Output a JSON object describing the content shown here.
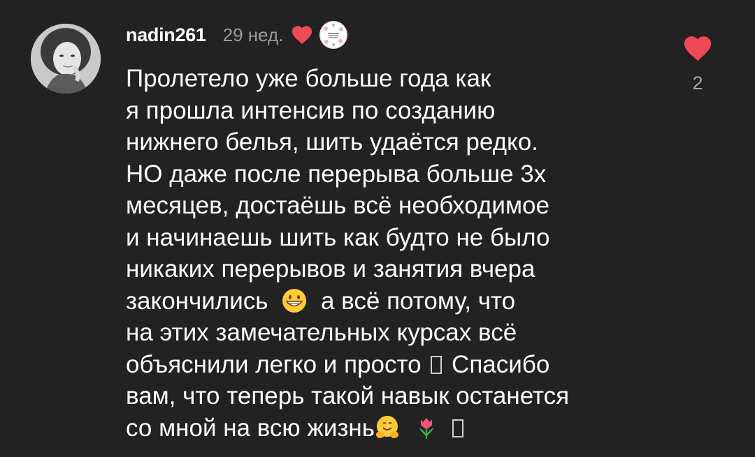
{
  "comment": {
    "username": "nadin261",
    "timestamp": "29 нед.",
    "liked_by_author": true,
    "author_badge": "author-avatar-icon",
    "lines": [
      "Пролетело уже больше года как",
      "я прошла интенсив по созданию",
      "нижнего белья, шить удаётся редко.",
      "НО даже после перерыва больше 3х",
      "месяцев, достаёшь всё необходимое",
      "и начинаешь шить как будто не было",
      "никаких перерывов и занятия вчера",
      "закончились",
      "а всё потому, что",
      "на этих замечательных курсах всё",
      "объяснили легко и просто",
      "Спасибо",
      "вам, что теперь такой навык останется",
      "со мной на всю жизнь"
    ],
    "like_count": "2",
    "icons": {
      "like": "heart-icon",
      "grin_emoji": "grinning-face-emoji",
      "hug_emoji": "hugging-face-emoji",
      "tulip_emoji": "tulip-emoji",
      "missing_glyph": "missing-glyph-box"
    }
  },
  "colors": {
    "background": "#222222",
    "text": "#ffffff",
    "muted": "#9b9b9b",
    "heart": "#ed4956"
  }
}
